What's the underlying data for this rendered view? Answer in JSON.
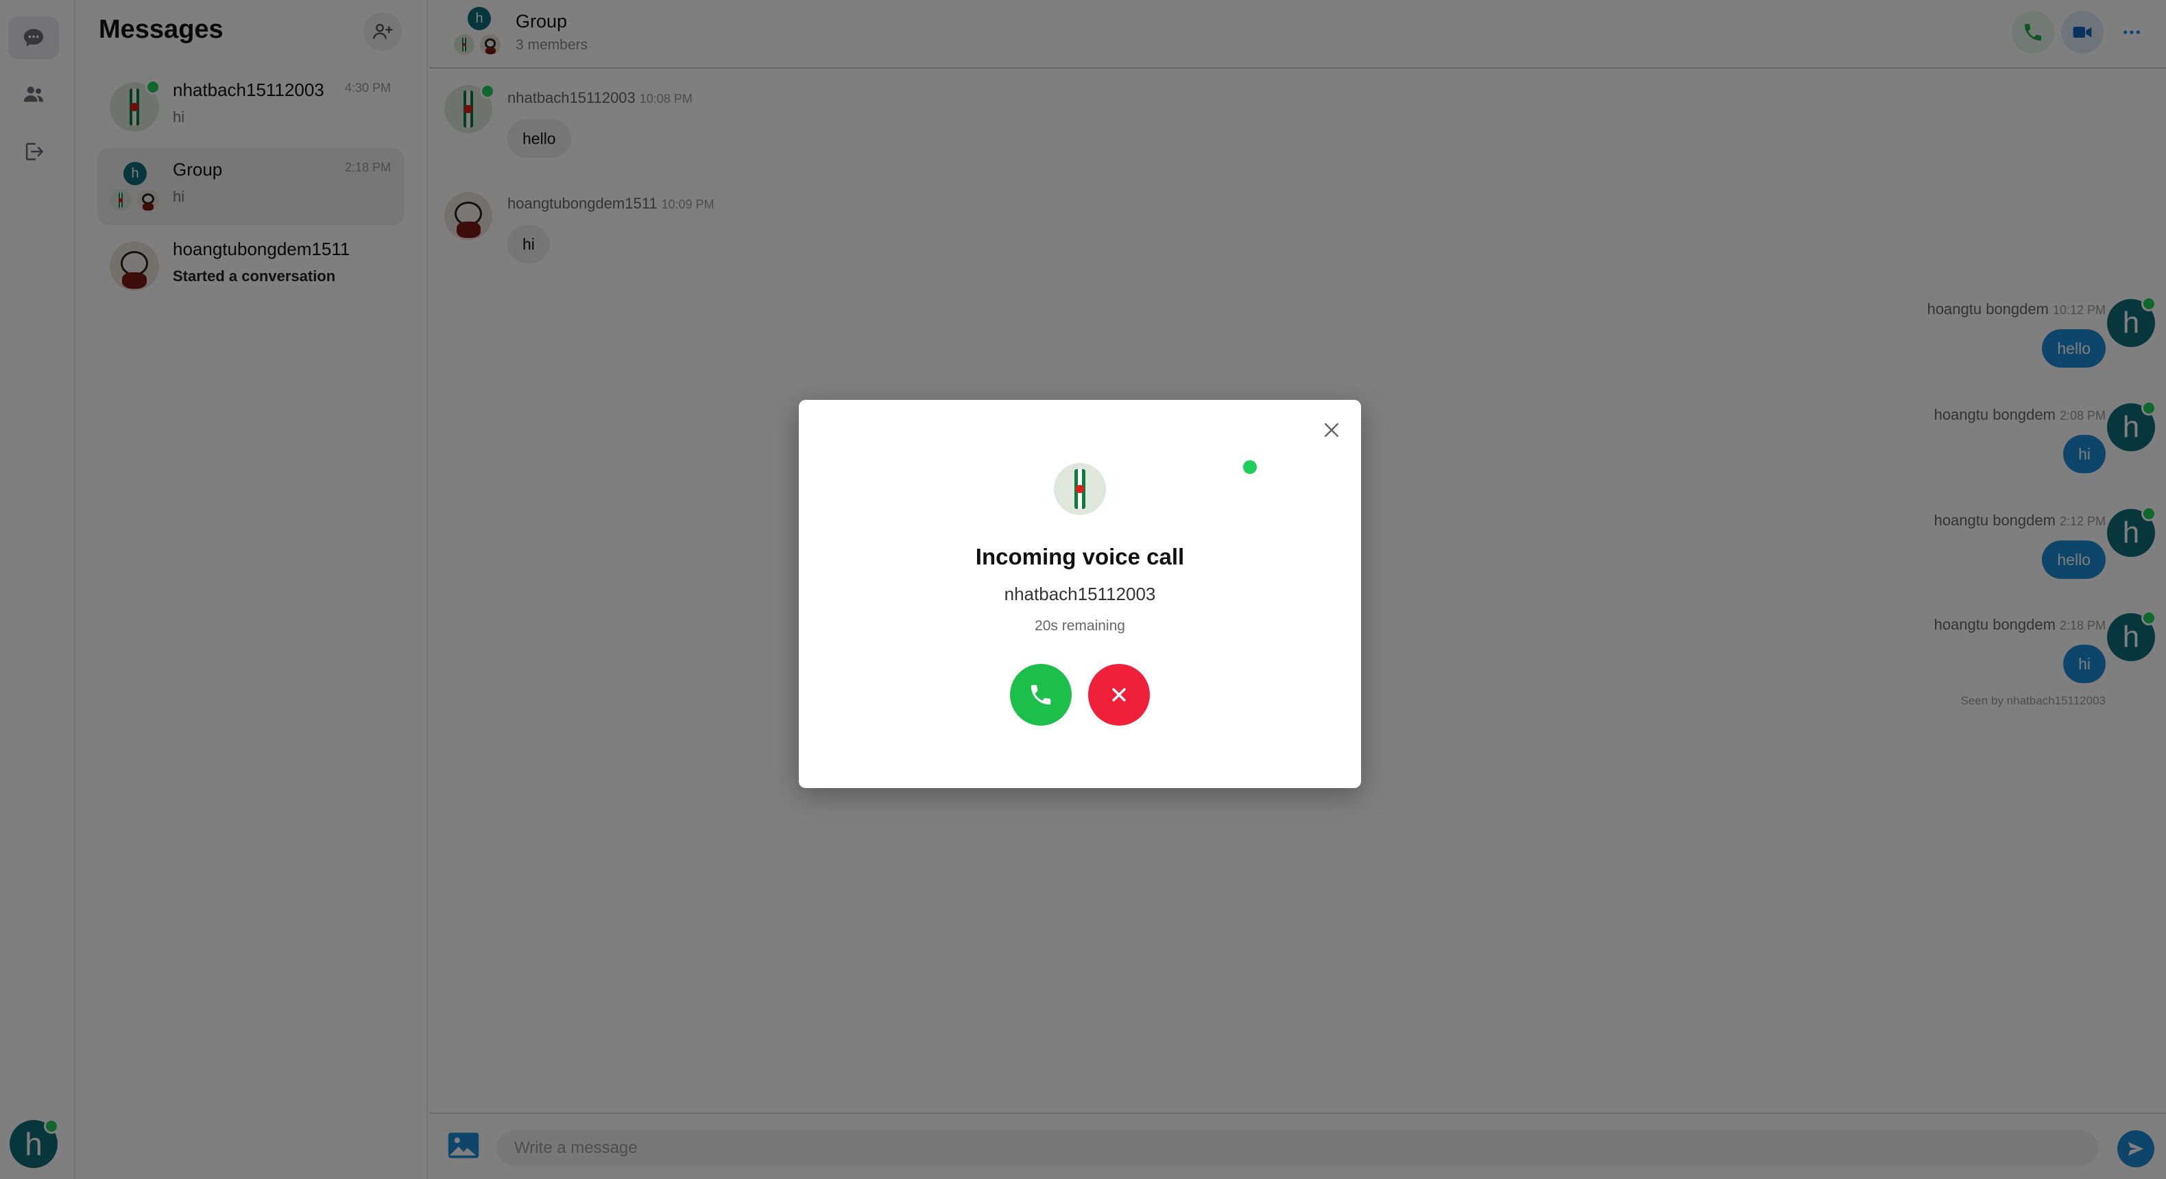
{
  "sidebar": {
    "items": [
      {
        "name": "chat-icon",
        "active": true
      },
      {
        "name": "contacts-icon",
        "active": false
      },
      {
        "name": "logout-icon",
        "active": false
      }
    ],
    "me": {
      "initial": "h",
      "online": true
    }
  },
  "conversations": {
    "title": "Messages",
    "add_icon": "add-user-icon",
    "items": [
      {
        "name": "nhatbach15112003",
        "time": "4:30 PM",
        "snippet": "hi",
        "avatar": "soda",
        "online": true,
        "active": false,
        "bold": false
      },
      {
        "name": "Group",
        "time": "2:18 PM",
        "snippet": "hi",
        "avatar": "group",
        "online": false,
        "active": true,
        "bold": false
      },
      {
        "name": "hoangtubongdem1511",
        "time": "",
        "snippet": "Started a conversation",
        "avatar": "bear",
        "online": false,
        "active": false,
        "bold": true
      }
    ]
  },
  "chat": {
    "header": {
      "title": "Group",
      "subtitle": "3 members",
      "group_avatar_initial": "h"
    },
    "actions": [
      {
        "name": "voice-call-icon",
        "color": "#1fa64a"
      },
      {
        "name": "video-call-icon",
        "color": "#1565c0"
      },
      {
        "name": "more-icon",
        "color": "#1a8ad6"
      }
    ],
    "messages_in": [
      {
        "sender": "nhatbach15112003",
        "time": "10:08 PM",
        "text": "hello"
      },
      {
        "sender": "hoangtubongdem1511",
        "time": "10:09 PM",
        "text": "hi"
      }
    ],
    "messages_out": [
      {
        "sender": "hoangtu bongdem",
        "time": "10:12 PM",
        "text": "hello"
      },
      {
        "sender": "hoangtu bongdem",
        "time": "2:08 PM",
        "text": "hi"
      },
      {
        "sender": "hoangtu bongdem",
        "time": "2:12 PM",
        "text": "hello"
      },
      {
        "sender": "hoangtu bongdem",
        "time": "2:18 PM",
        "text": "hi"
      }
    ],
    "seen": "Seen by nhatbach15112003",
    "composer": {
      "placeholder": "Write a message",
      "image_icon": "image-icon",
      "send_icon": "send-icon"
    }
  },
  "call_modal": {
    "title": "Incoming voice call",
    "caller": "nhatbach15112003",
    "timer": "20s remaining",
    "accept_color": "#1cbf4a",
    "decline_color": "#f0203a"
  },
  "colors": {
    "accent": "#1a8ad6",
    "online": "#1fcf5a",
    "avatar_h": "#0e6f78"
  }
}
